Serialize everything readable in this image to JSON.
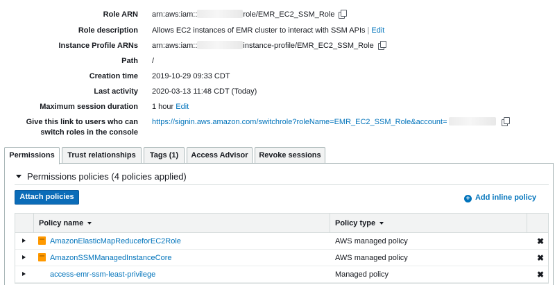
{
  "summary": {
    "role_arn": {
      "label": "Role ARN",
      "prefix": "arn:aws:iam::",
      "suffix": "role/EMR_EC2_SSM_Role"
    },
    "role_description": {
      "label": "Role description",
      "value": "Allows EC2 instances of EMR cluster to interact with SSM APIs",
      "edit": "Edit"
    },
    "instance_profile_arns": {
      "label": "Instance Profile ARNs",
      "prefix": "arn:aws:iam::",
      "suffix": "instance-profile/EMR_EC2_SSM_Role"
    },
    "path": {
      "label": "Path",
      "value": "/"
    },
    "creation_time": {
      "label": "Creation time",
      "value": "2019-10-29 09:33 CDT"
    },
    "last_activity": {
      "label": "Last activity",
      "value": "2020-03-13 11:48 CDT (Today)"
    },
    "max_session": {
      "label": "Maximum session duration",
      "value": "1 hour",
      "edit": "Edit"
    },
    "switch_link": {
      "label_line1": "Give this link to users who can",
      "label_line2": "switch roles in the console",
      "url": "https://signin.aws.amazon.com/switchrole?roleName=EMR_EC2_SSM_Role&account="
    }
  },
  "tabs": [
    "Permissions",
    "Trust relationships",
    "Tags (1)",
    "Access Advisor",
    "Revoke sessions"
  ],
  "permissions": {
    "section_title": "Permissions policies (4 policies applied)",
    "attach_button": "Attach policies",
    "add_inline": "Add inline policy",
    "columns": {
      "name": "Policy name",
      "type": "Policy type"
    },
    "rows": [
      {
        "name": "AmazonElasticMapReduceforEC2Role",
        "type": "AWS managed policy",
        "icon": "aws-managed-policy-icon"
      },
      {
        "name": "AmazonSSMManagedInstanceCore",
        "type": "AWS managed policy",
        "icon": "aws-managed-policy-icon"
      },
      {
        "name": "access-emr-ssm-least-privilege",
        "type": "Managed policy",
        "icon": ""
      }
    ]
  },
  "colors": {
    "link": "#0073bb",
    "primary_button": "#0b6cb8",
    "aws_policy_icon": "#ff9900"
  }
}
